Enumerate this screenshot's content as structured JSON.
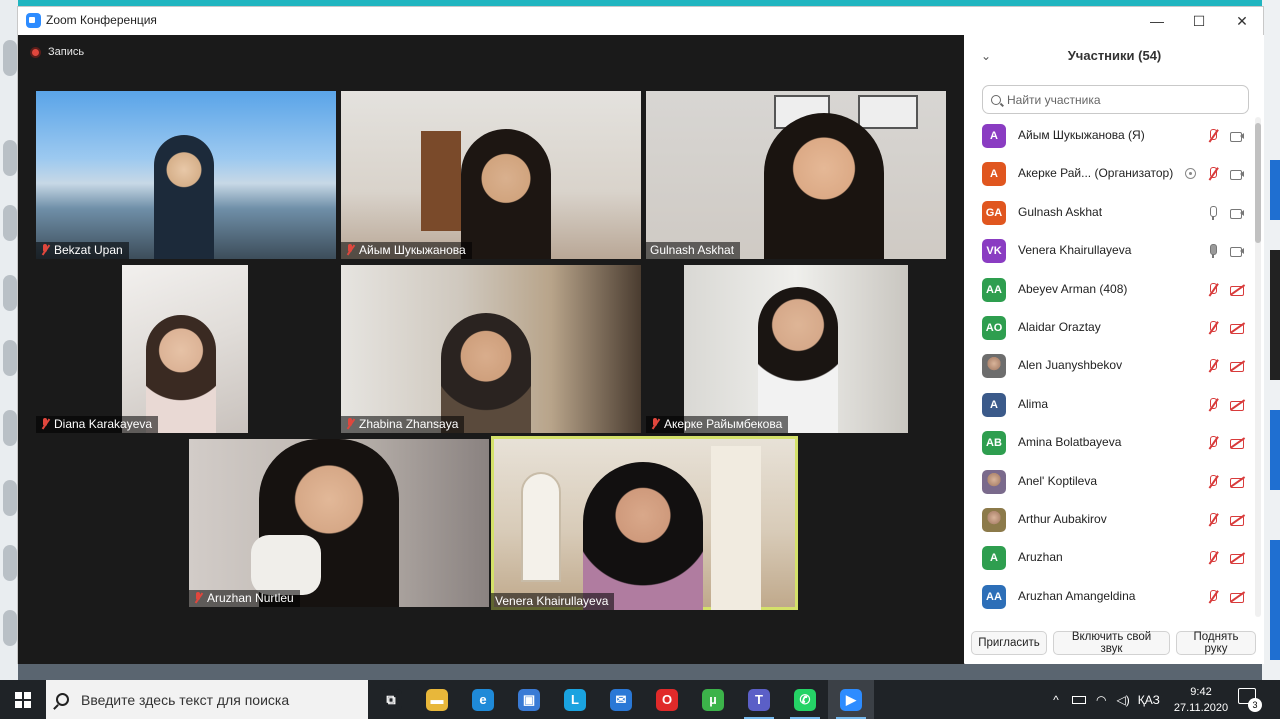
{
  "window": {
    "title": "Zoom Конференция",
    "minimize_glyph": "—",
    "maximize_glyph": "☐",
    "close_glyph": "✕"
  },
  "recording": {
    "label": "Запись"
  },
  "video_tiles": [
    {
      "name": "Bekzat Upan",
      "muted": true,
      "active": false
    },
    {
      "name": "Айым Шукыжанова",
      "muted": true,
      "active": false
    },
    {
      "name": "Gulnash Askhat",
      "muted": false,
      "active": false
    },
    {
      "name": "Diana Karakayeva",
      "muted": true,
      "active": false
    },
    {
      "name": "Zhabina Zhansaya",
      "muted": true,
      "active": false
    },
    {
      "name": "Акерке Райымбекова",
      "muted": true,
      "active": false
    },
    {
      "name": "Aruzhan Nurtleu",
      "muted": true,
      "active": false
    },
    {
      "name": "Venera Khairullayeva",
      "muted": false,
      "active": true
    }
  ],
  "participants_panel": {
    "title": "Участники (54)",
    "search_placeholder": "Найти участника",
    "participants": [
      {
        "initials": "А",
        "name": "Айым Шукыжанова (Я)",
        "avatar_color": "#8a3cc2",
        "mic": "muted",
        "video": "on"
      },
      {
        "initials": "А",
        "name": "Акерке Рай...  (Организатор)",
        "avatar_color": "#e0561f",
        "mic": "muted",
        "video": "on",
        "host_icon": true
      },
      {
        "initials": "GA",
        "name": "Gulnash Askhat",
        "avatar_color": "#e0561f",
        "mic": "on",
        "video": "on"
      },
      {
        "initials": "VK",
        "name": "Venera Khairullayeva",
        "avatar_color": "#8a3cc2",
        "mic": "live",
        "video": "on"
      },
      {
        "initials": "AA",
        "name": "Abeyev Arman (408)",
        "avatar_color": "#2e9e4f",
        "mic": "muted",
        "video": "off"
      },
      {
        "initials": "AO",
        "name": "Alaidar Oraztay",
        "avatar_color": "#2e9e4f",
        "mic": "muted",
        "video": "off"
      },
      {
        "initials": "",
        "name": "Alen Juanyshbekov",
        "avatar_color": "#6d6d6d",
        "mic": "muted",
        "video": "off",
        "photo": true
      },
      {
        "initials": "A",
        "name": "Alima",
        "avatar_color": "#3b5a8a",
        "mic": "muted",
        "video": "off"
      },
      {
        "initials": "AB",
        "name": "Amina Bolatbayeva",
        "avatar_color": "#2e9e4f",
        "mic": "muted",
        "video": "off"
      },
      {
        "initials": "",
        "name": "Anel' Koptileva",
        "avatar_color": "#7a6a8c",
        "mic": "muted",
        "video": "off",
        "photo": true
      },
      {
        "initials": "",
        "name": "Arthur Aubakirov",
        "avatar_color": "#8c7a4a",
        "mic": "muted",
        "video": "off",
        "photo": true
      },
      {
        "initials": "A",
        "name": "Aruzhan",
        "avatar_color": "#2e9e4f",
        "mic": "muted",
        "video": "off"
      },
      {
        "initials": "AA",
        "name": "Aruzhan Amangeldina",
        "avatar_color": "#2d6fb8",
        "mic": "muted",
        "video": "off"
      }
    ],
    "footer_buttons": [
      "Пригласить",
      "Включить свой звук",
      "Поднять руку"
    ]
  },
  "taskbar": {
    "search_placeholder": "Введите здесь текст для поиска",
    "apps": [
      {
        "name": "task-view",
        "glyph": "⧉",
        "color": "#1f2327"
      },
      {
        "name": "file-explorer",
        "glyph": "▬",
        "color": "#e8b73a"
      },
      {
        "name": "edge",
        "glyph": "e",
        "color": "#1f8ad8"
      },
      {
        "name": "store",
        "glyph": "▣",
        "color": "#3a7bd5"
      },
      {
        "name": "app-l",
        "glyph": "L",
        "color": "#1aa3e0"
      },
      {
        "name": "mail",
        "glyph": "✉",
        "color": "#2a78d6"
      },
      {
        "name": "opera",
        "glyph": "O",
        "color": "#e02a2a"
      },
      {
        "name": "utorrent",
        "glyph": "µ",
        "color": "#3cb34a"
      },
      {
        "name": "teams",
        "glyph": "T",
        "color": "#5b5fc7"
      },
      {
        "name": "whatsapp",
        "glyph": "✆",
        "color": "#25d366"
      },
      {
        "name": "zoom",
        "glyph": "▶",
        "color": "#2d8cff"
      }
    ],
    "tray": {
      "chevron": "^",
      "language": "ҚАЗ",
      "time": "9:42",
      "date": "27.11.2020",
      "notification_count": "3"
    }
  }
}
